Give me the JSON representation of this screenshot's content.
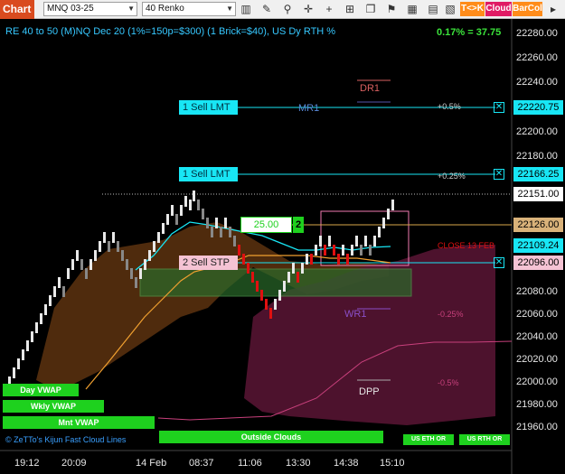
{
  "toolbar": {
    "title": "Chart",
    "instrument": "MNQ 03-25",
    "bar_type": "40 Renko",
    "btn_tk": "T<>K",
    "btn_cloud": "Cloud",
    "btn_barcol": "BarCol"
  },
  "chart": {
    "header": "RE 40 to 50 (M)NQ Dec 20 (1%=150p=$300) (1 Brick=$40), US Dy RTH %",
    "pct_change": "0.17% = 37.75",
    "orders": {
      "sell_lmt_1": "1 Sell LMT",
      "sell_lmt_2": "1 Sell LMT",
      "sell_stp": "2 Sell STP",
      "qty_value": "25.00",
      "qty_count": "2"
    },
    "levels": {
      "dr1": "DR1",
      "mr1": "MR1",
      "wr1": "WR1",
      "dpp": "DPP",
      "plus_05": "+0.5%",
      "plus_025": "+0.25%",
      "minus_025": "-0.25%",
      "minus_05": "-0.5%",
      "close_label": "CLOSE 13 FEB"
    },
    "price_tags": {
      "p1": "22220.75",
      "p2": "22166.25",
      "p3": "22151.00",
      "p4": "22126.00",
      "p5": "22109.24",
      "p6": "22096.00"
    },
    "y_axis": [
      "22280.00",
      "22260.00",
      "22240.00",
      "22220.00",
      "22200.00",
      "22180.00",
      "22160.00",
      "22140.00",
      "22120.00",
      "22100.00",
      "22080.00",
      "22060.00",
      "22040.00",
      "22020.00",
      "22000.00",
      "21980.00",
      "21960.00"
    ],
    "x_axis": [
      "19:12",
      "20:09",
      "14 Feb",
      "08:37",
      "11:06",
      "13:30",
      "14:38",
      "15:10"
    ],
    "vwap": {
      "day": "Day VWAP",
      "wkly": "Wkly VWAP",
      "mnt": "Mnt VWAP",
      "outside": "Outside Clouds",
      "us_eth": "US ETH OR",
      "us_rth": "US RTH OR"
    },
    "legend": "© ZeTTo's Kijun Fast Cloud Lines",
    "colors": {
      "up_brick": "#ffffff",
      "down_brick": "#e01010",
      "cyan": "#18e6f5",
      "orange": "#f0a030",
      "magenta": "#c8407c"
    }
  }
}
